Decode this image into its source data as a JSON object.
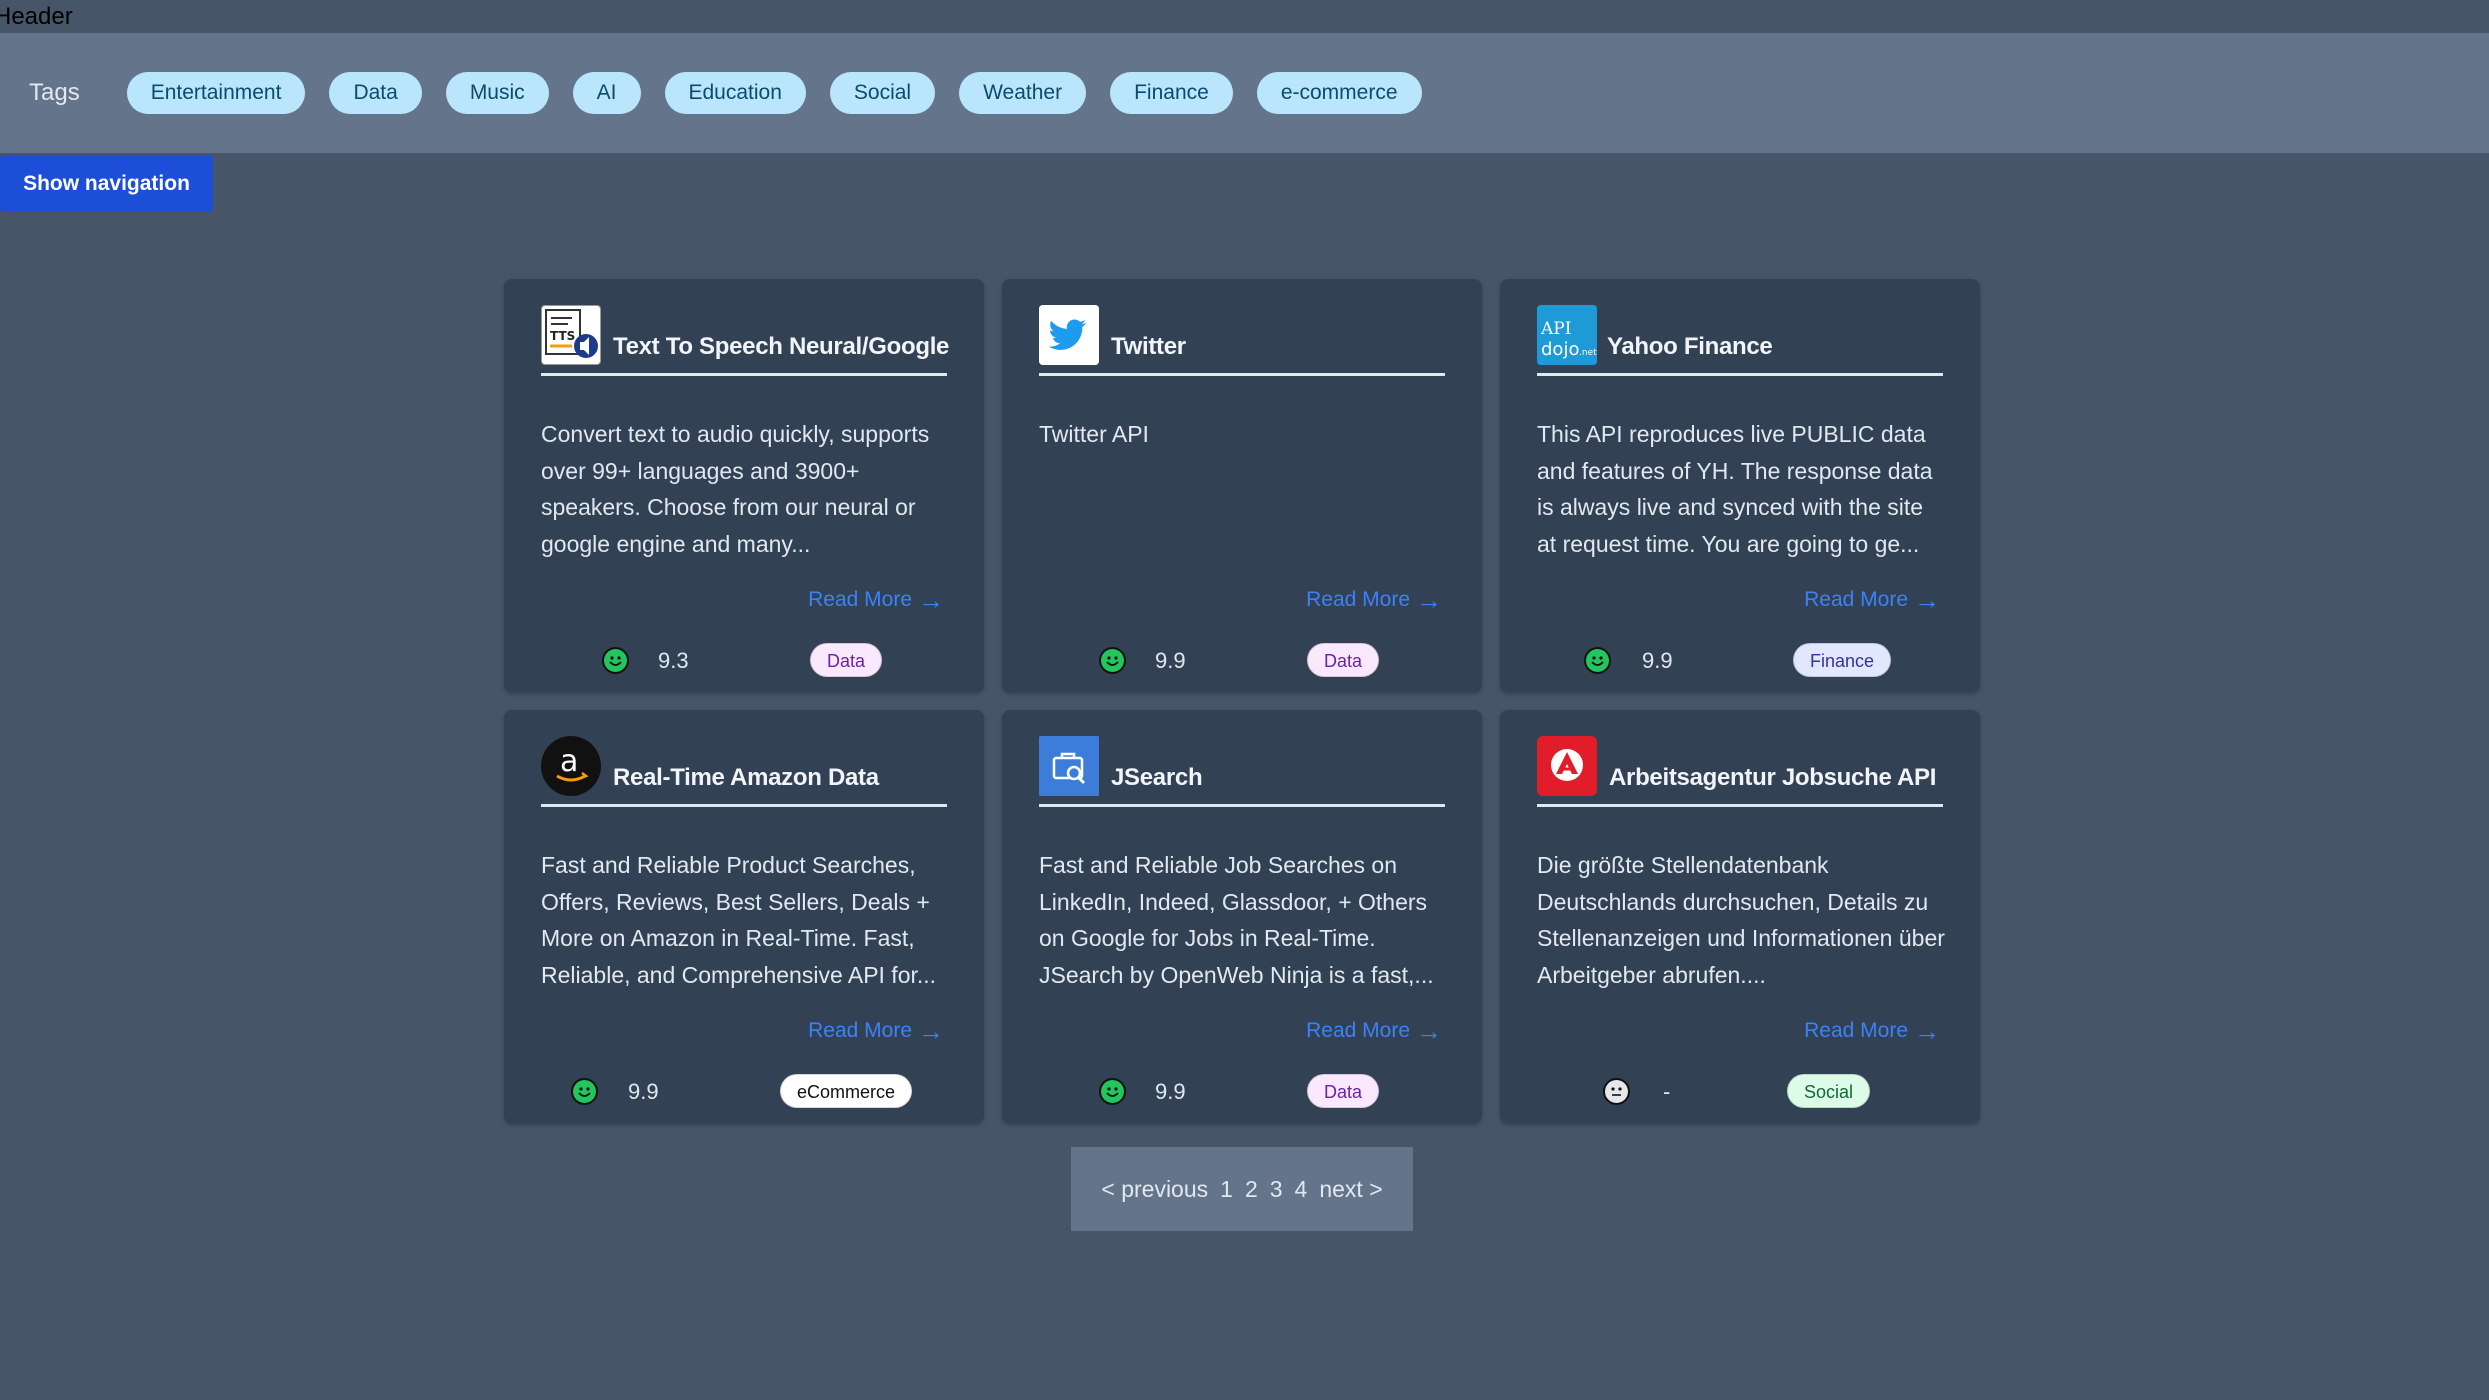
{
  "header": {
    "title": "Header"
  },
  "tags": {
    "label": "Tags",
    "items": [
      "Entertainment",
      "Data",
      "Music",
      "AI",
      "Education",
      "Social",
      "Weather",
      "Finance",
      "e-commerce"
    ]
  },
  "nav_button": "Show navigation",
  "read_more_label": "Read More",
  "cards": [
    {
      "title": "Text To Speech Neural/Google",
      "description": "Convert text to audio quickly, supports over 99+ languages and 3900+ speakers. Choose from our neural or google engine and many...",
      "score": "9.3",
      "badge": "Data",
      "icon": "tts-logo-icon"
    },
    {
      "title": "Twitter",
      "description": "Twitter API",
      "score": "9.9",
      "badge": "Data",
      "icon": "twitter-logo-icon"
    },
    {
      "title": "Yahoo Finance",
      "description": "This API reproduces live PUBLIC data and features of YH. The response data is always live and synced with the site at request time. You are going to ge...",
      "score": "9.9",
      "badge": "Finance",
      "icon": "apidojo-logo-icon",
      "logo_text": "API dojo.net"
    },
    {
      "title": "Real-Time Amazon Data",
      "description": "Fast and Reliable Product Searches, Offers, Reviews, Best Sellers, Deals + More on Amazon in Real-Time. Fast, Reliable, and Comprehensive API for...",
      "score": "9.9",
      "badge": "eCommerce",
      "icon": "amazon-logo-icon"
    },
    {
      "title": "JSearch",
      "description": "Fast and Reliable Job Searches on LinkedIn, Indeed, Glassdoor, + Others on Google for Jobs in Real-Time. JSearch by OpenWeb Ninja is a fast,...",
      "score": "9.9",
      "badge": "Data",
      "icon": "jsearch-logo-icon"
    },
    {
      "title": "Arbeitsagentur Jobsuche API",
      "description": "Die größte Stellendatenbank Deutschlands durchsuchen, Details zu Stellenanzeigen und Informationen über Arbeitgeber abrufen....",
      "score": "-",
      "badge": "Social",
      "icon": "arbeitsagentur-logo-icon"
    }
  ],
  "pagination": {
    "previous": "< previous",
    "pages": [
      "1",
      "2",
      "3",
      "4"
    ],
    "next": "next >"
  },
  "colors": {
    "background": "#475569",
    "card": "#334155",
    "tag_pill": "#bae6fd",
    "nav_button": "#1d4ed8",
    "link": "#3b82f6",
    "good_face": "#22c55e",
    "neutral_face": "#e5e7eb"
  }
}
